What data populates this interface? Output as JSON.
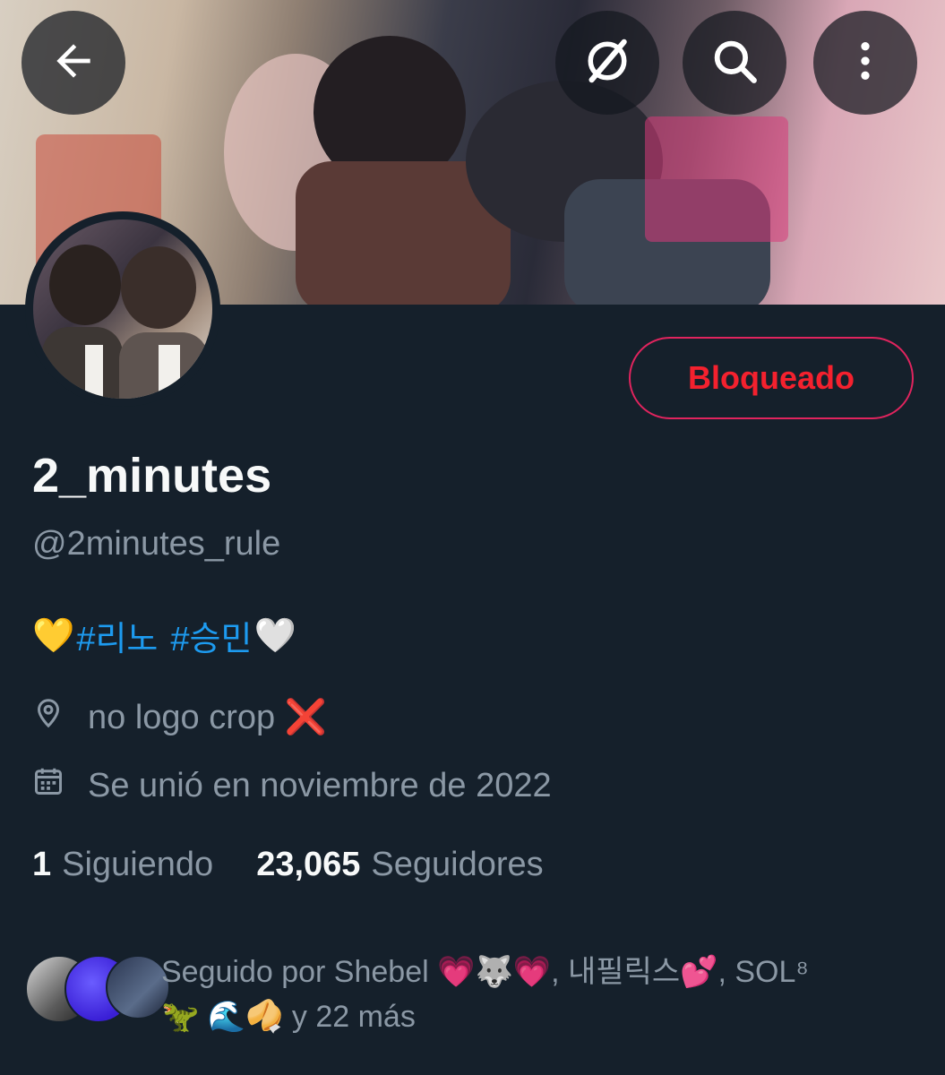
{
  "profile": {
    "display_name": "2_minutes",
    "handle": "@2minutes_rule",
    "bio": {
      "emoji_start": "💛",
      "tag1": "#리노",
      "tag2": "#승민",
      "emoji_end": "🤍"
    },
    "location": "no logo crop ❌",
    "joined": "Se unió en noviembre de 2022"
  },
  "actions": {
    "blocked_label": "Bloqueado"
  },
  "stats": {
    "following_count": "1",
    "following_label": "Siguiendo",
    "followers_count": "23,065",
    "followers_label": "Seguidores"
  },
  "followed_by": {
    "line1": "Seguido por Shebel 💗🐺💗, 내필릭스💕, SOL⁸",
    "line2": "🦖 🌊🥠 y 22 más"
  },
  "icons": {
    "back": "arrow-left-icon",
    "grok": "grok-icon",
    "search": "search-icon",
    "more": "more-vertical-icon",
    "location": "location-pin-icon",
    "calendar": "calendar-icon"
  },
  "colors": {
    "background": "#15202b",
    "accent": "#1d9bf0",
    "blocked": "#f4212e",
    "secondary_text": "#8b98a5"
  }
}
